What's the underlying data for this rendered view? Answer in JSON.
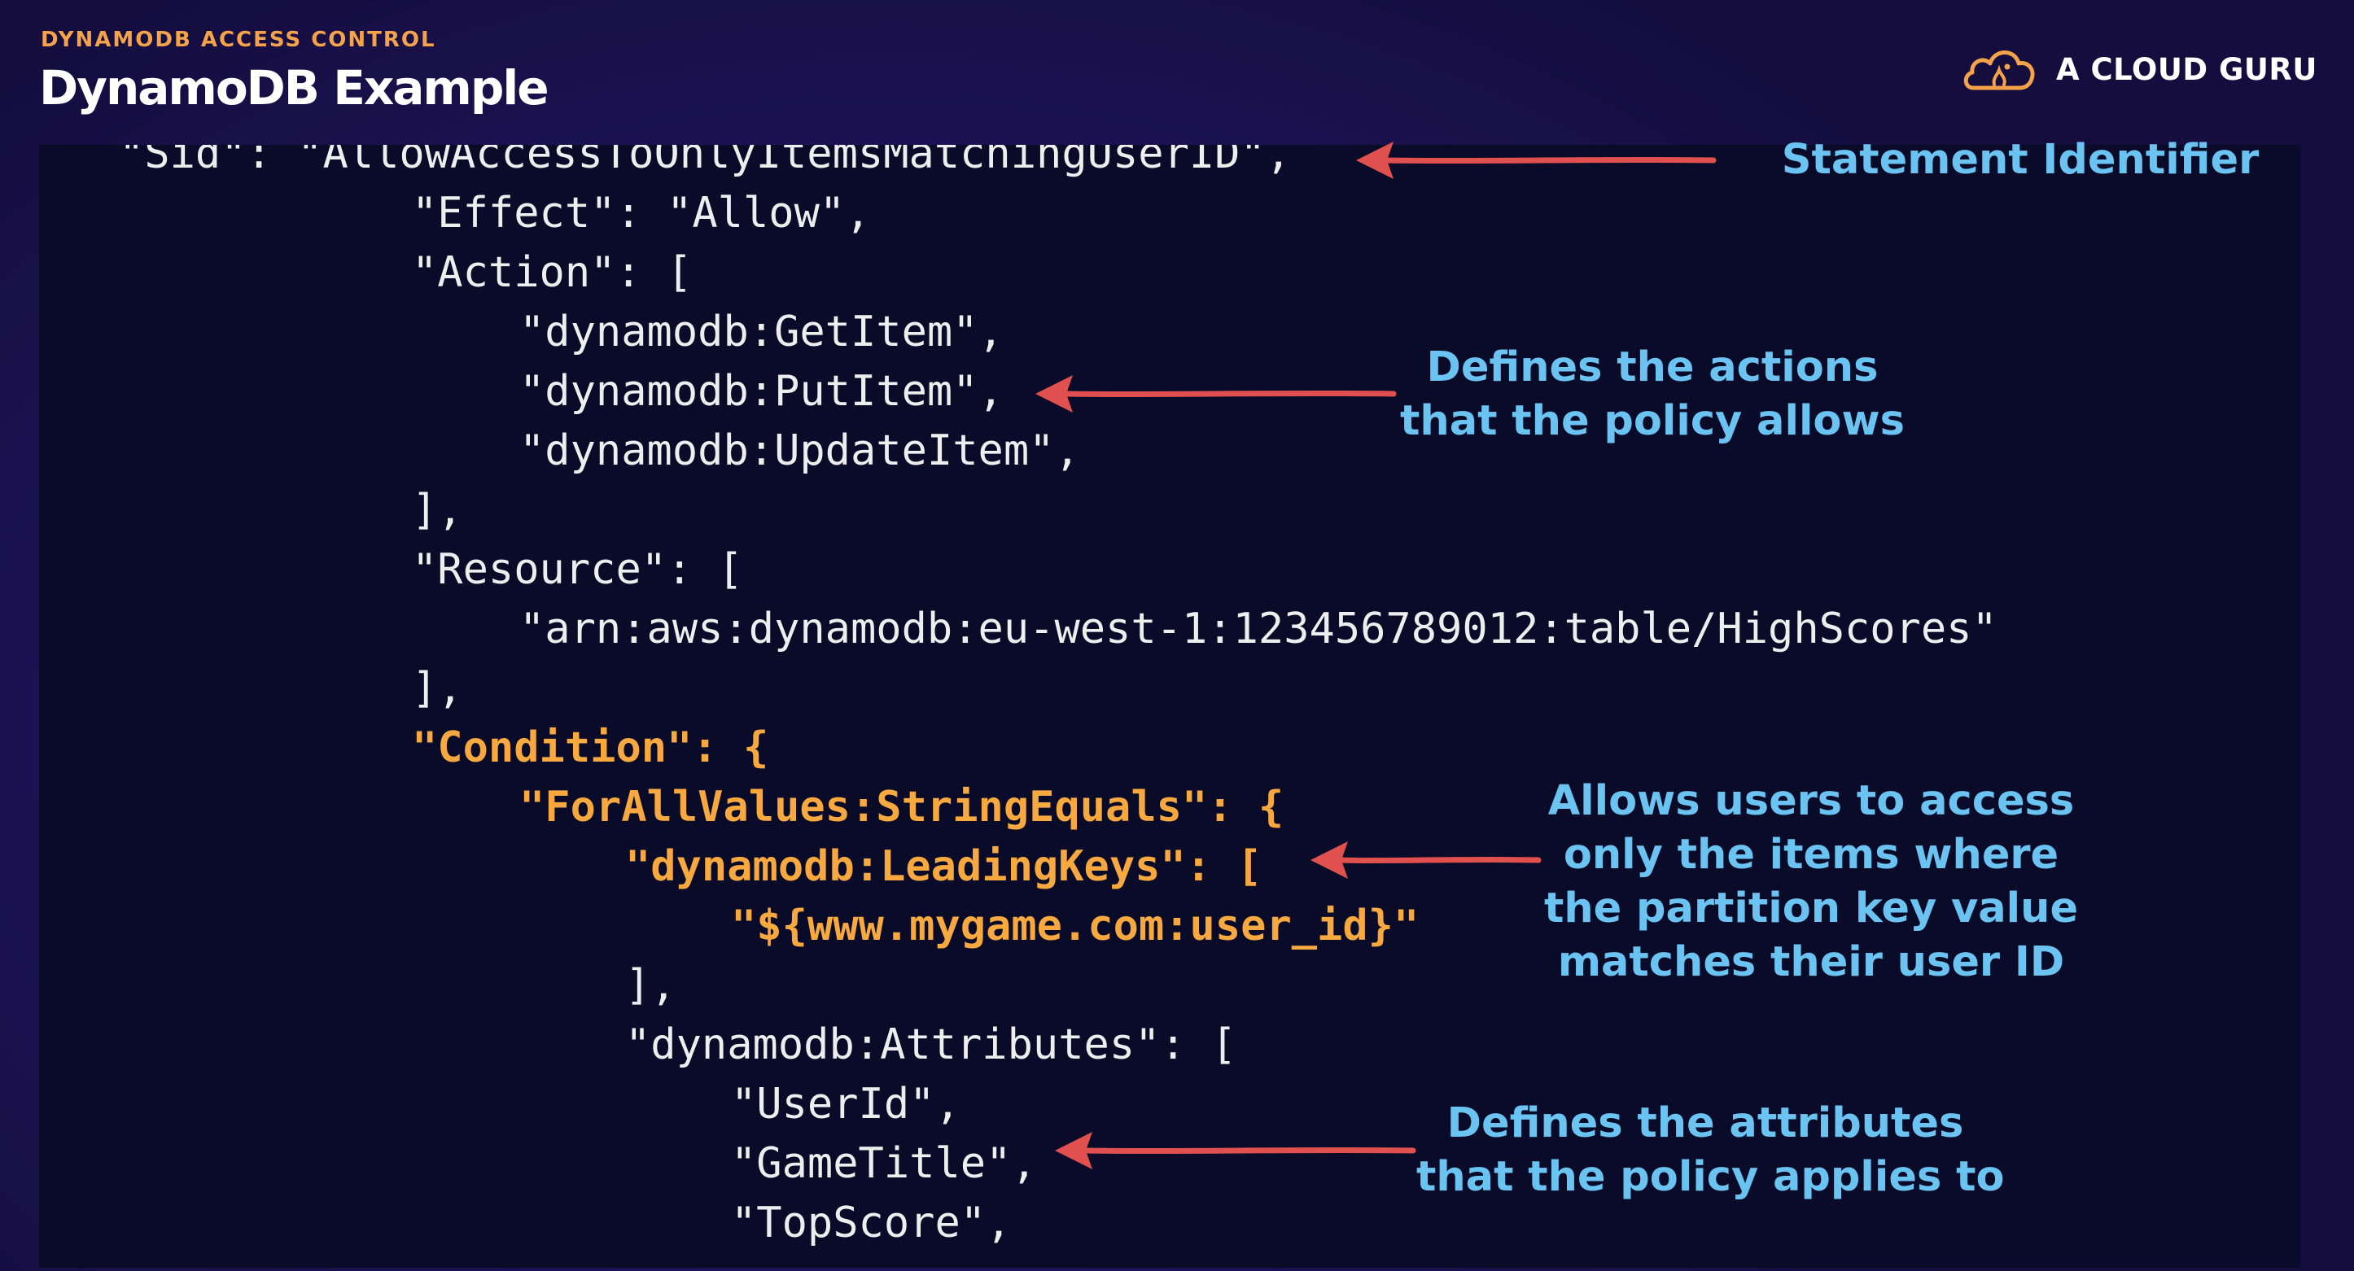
{
  "header": {
    "eyebrow": "DYNAMODB ACCESS CONTROL",
    "title": "DynamoDB Example"
  },
  "brand": {
    "name": "A CLOUD GURU",
    "icon": "cloud-logo-icon"
  },
  "code": {
    "lines": [
      "\"Sid\": \"AllowAccessToOnlyItemsMatchingUserID\",",
      "\"Effect\": \"Allow\",",
      "\"Action\": [",
      "\"dynamodb:GetItem\",",
      "\"dynamodb:PutItem\",",
      "\"dynamodb:UpdateItem\",",
      "],",
      "\"Resource\": [",
      "\"arn:aws:dynamodb:eu-west-1:123456789012:table/HighScores\"",
      "],",
      "\"Condition\": {",
      "\"ForAllValues:StringEquals\": {",
      "\"dynamodb:LeadingKeys\": [",
      "\"${www.mygame.com:user_id}\"",
      "],",
      "\"dynamodb:Attributes\": [",
      "\"UserId\",",
      "\"GameTitle\",",
      "\"TopScore\","
    ]
  },
  "annotations": {
    "statement_identifier": [
      "Statement Identifier"
    ],
    "actions": [
      "Defines the actions",
      "that  the policy allows"
    ],
    "leading_keys": [
      "Allows users to access",
      "only the items where",
      "the partition key value",
      "matches their user ID"
    ],
    "attributes": [
      "Defines the attributes",
      "that the policy applies to"
    ]
  },
  "colors": {
    "background": "#221660",
    "code_panel": "#0a0b28",
    "code_text": "#eeeeee",
    "code_highlight": "#f7a83e",
    "annotation_text": "#6bc3f2",
    "arrow": "#e0504f",
    "eyebrow": "#f4a34b",
    "brand_logo": "#f4a34b"
  }
}
